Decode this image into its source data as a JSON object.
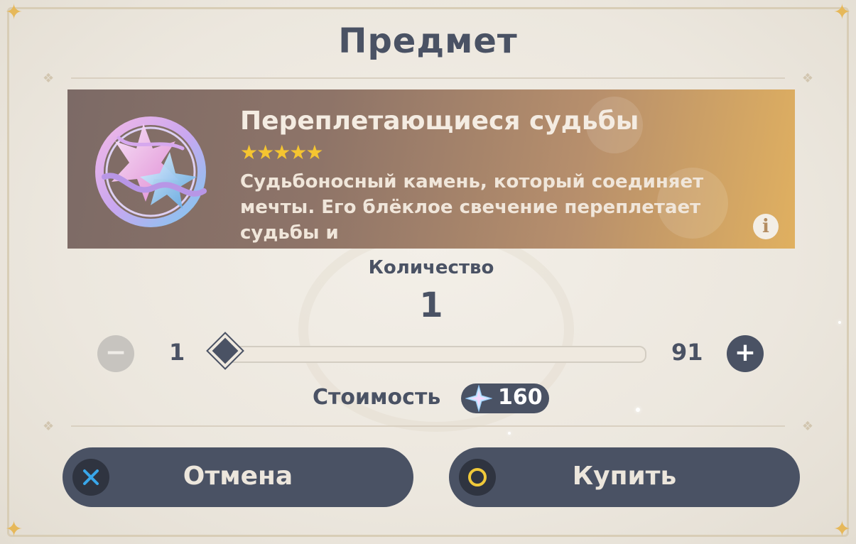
{
  "dialog": {
    "title": "Предмет"
  },
  "item": {
    "name": "Переплетающиеся судьбы",
    "rarity_stars": "★★★★★",
    "rarity": 5,
    "description": "Судьбоносный камень, который соединяет мечты. Его блёклое свечение переплетает судьбы и",
    "icon": "intertwined-fate-icon",
    "info_icon": "info-icon",
    "info_glyph": "i"
  },
  "quantity": {
    "label": "Количество",
    "value": "1",
    "min": "1",
    "max": "91",
    "minus_glyph": "−",
    "plus_glyph": "+"
  },
  "cost": {
    "label": "Стоимость",
    "value": "160",
    "currency_icon": "primogem-icon"
  },
  "buttons": {
    "cancel_label": "Отмена",
    "buy_label": "Купить",
    "cancel_icon": "cross-icon",
    "buy_icon": "circle-icon"
  },
  "colors": {
    "text": "#4a5264",
    "card_gradient_start": "#7c6a66",
    "card_gradient_end": "#e0b060",
    "star": "#f5c530",
    "cancel_cross": "#39a7ea",
    "buy_circle": "#f0c93a"
  }
}
